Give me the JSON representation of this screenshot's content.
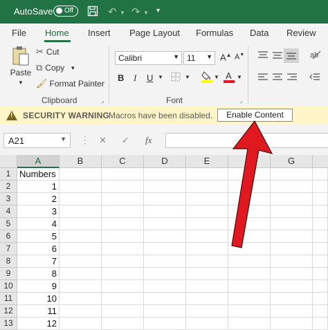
{
  "titlebar": {
    "autosave_label": "AutoSave",
    "toggle_state": "Off"
  },
  "tabs": [
    "File",
    "Home",
    "Insert",
    "Page Layout",
    "Formulas",
    "Data",
    "Review"
  ],
  "clipboard": {
    "paste": "Paste",
    "cut": "Cut",
    "copy": "Copy",
    "format_painter": "Format Painter",
    "group": "Clipboard"
  },
  "font": {
    "family": "Calibri",
    "size": "11",
    "group": "Font"
  },
  "security": {
    "title": "SECURITY WARNING",
    "message": "Macros have been disabled.",
    "button": "Enable Content"
  },
  "formula_bar": {
    "name_box": "A21",
    "cancel": "✕",
    "enter": "✓",
    "fx": "fx",
    "formula": ""
  },
  "columns": [
    "A",
    "B",
    "C",
    "D",
    "E",
    "F",
    "G"
  ],
  "selected_column": "A",
  "rows": [
    {
      "num": "1",
      "a": "Numbers"
    },
    {
      "num": "2",
      "a": "1"
    },
    {
      "num": "3",
      "a": "2"
    },
    {
      "num": "4",
      "a": "3"
    },
    {
      "num": "5",
      "a": "4"
    },
    {
      "num": "6",
      "a": "5"
    },
    {
      "num": "7",
      "a": "6"
    },
    {
      "num": "8",
      "a": "7"
    },
    {
      "num": "9",
      "a": "8"
    },
    {
      "num": "10",
      "a": "9"
    },
    {
      "num": "11",
      "a": "10"
    },
    {
      "num": "12",
      "a": "11"
    },
    {
      "num": "13",
      "a": "12"
    }
  ],
  "colors": {
    "brand": "#217346",
    "warning_bar": "#fff5c7",
    "annotation_arrow": "#e0181f"
  }
}
